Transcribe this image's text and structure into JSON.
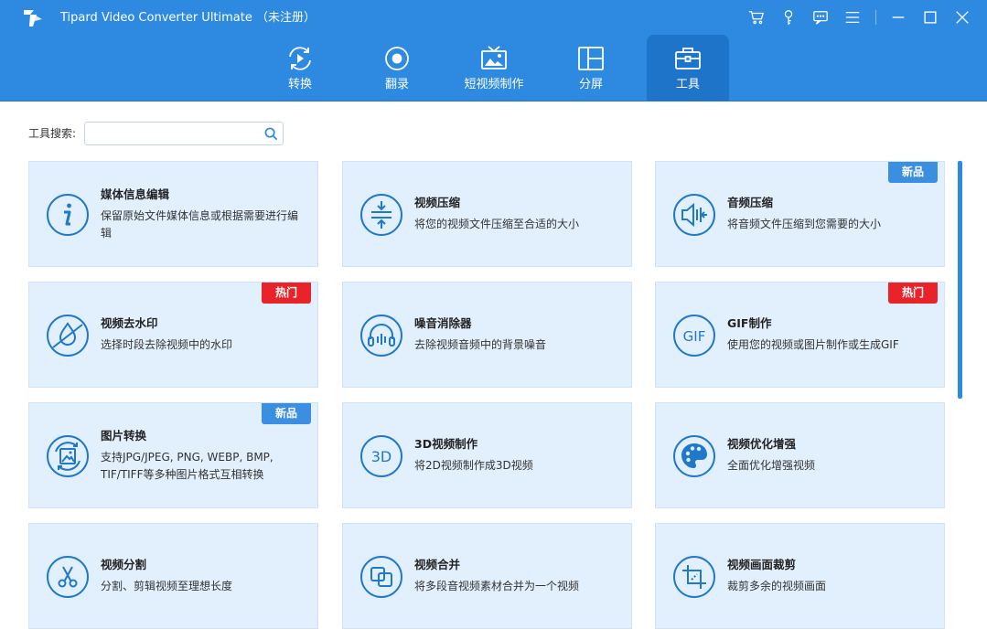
{
  "app": {
    "title": "Tipard Video Converter Ultimate （未注册）",
    "accent_color": "#2d8ae0",
    "logo_icon": "tipard-logo-icon"
  },
  "window_controls": [
    {
      "name": "cart-icon"
    },
    {
      "name": "key-icon"
    },
    {
      "name": "feedback-icon"
    },
    {
      "name": "menu-icon"
    },
    {
      "name": "minimize-icon"
    },
    {
      "name": "maximize-icon"
    },
    {
      "name": "close-icon"
    }
  ],
  "tabs": [
    {
      "label": "转换",
      "icon": "convert-icon",
      "active": false
    },
    {
      "label": "翻录",
      "icon": "ripper-icon",
      "active": false
    },
    {
      "label": "短视频制作",
      "icon": "mv-icon",
      "active": false
    },
    {
      "label": "分屏",
      "icon": "collage-icon",
      "active": false
    },
    {
      "label": "工具",
      "icon": "toolbox-icon",
      "active": true
    }
  ],
  "search": {
    "label": "工具搜索:",
    "value": "",
    "placeholder": ""
  },
  "tools": [
    {
      "title": "媒体信息编辑",
      "desc": "保留原始文件媒体信息或根据需要进行编辑",
      "icon": "info-icon",
      "badge": ""
    },
    {
      "title": "视频压缩",
      "desc": "将您的视频文件压缩至合适的大小",
      "icon": "compress-icon",
      "badge": ""
    },
    {
      "title": "音频压缩",
      "desc": "将音频文件压缩到您需要的大小",
      "icon": "audio-compress-icon",
      "badge": "新品"
    },
    {
      "title": "视频去水印",
      "desc": "选择时段去除视频中的水印",
      "icon": "watermark-remove-icon",
      "badge": "热门"
    },
    {
      "title": "噪音消除器",
      "desc": "去除视频音频中的背景噪音",
      "icon": "headphones-icon",
      "badge": ""
    },
    {
      "title": "GIF制作",
      "desc": "使用您的视频或图片制作或生成GIF",
      "icon": "gif-icon",
      "badge": "热门"
    },
    {
      "title": "图片转换",
      "desc": "支持JPG/JPEG, PNG, WEBP, BMP, TIF/TIFF等多种图片格式互相转换",
      "icon": "image-convert-icon",
      "badge": "新品"
    },
    {
      "title": "3D视频制作",
      "desc": "将2D视频制作成3D视频",
      "icon": "3d-icon",
      "badge": ""
    },
    {
      "title": "视频优化增强",
      "desc": "全面优化增强视频",
      "icon": "palette-icon",
      "badge": ""
    },
    {
      "title": "视频分割",
      "desc": "分割、剪辑视频至理想长度",
      "icon": "scissors-icon",
      "badge": ""
    },
    {
      "title": "视频合并",
      "desc": "将多段音视频素材合并为一个视频",
      "icon": "merge-icon",
      "badge": ""
    },
    {
      "title": "视频画面裁剪",
      "desc": "裁剪多余的视频画面",
      "icon": "crop-icon",
      "badge": ""
    }
  ],
  "colors": {
    "card_bg": "#e2effc",
    "badge_new": "#3b8fe0",
    "badge_hot": "#e8242a",
    "icon_blue": "#1f78c9"
  }
}
